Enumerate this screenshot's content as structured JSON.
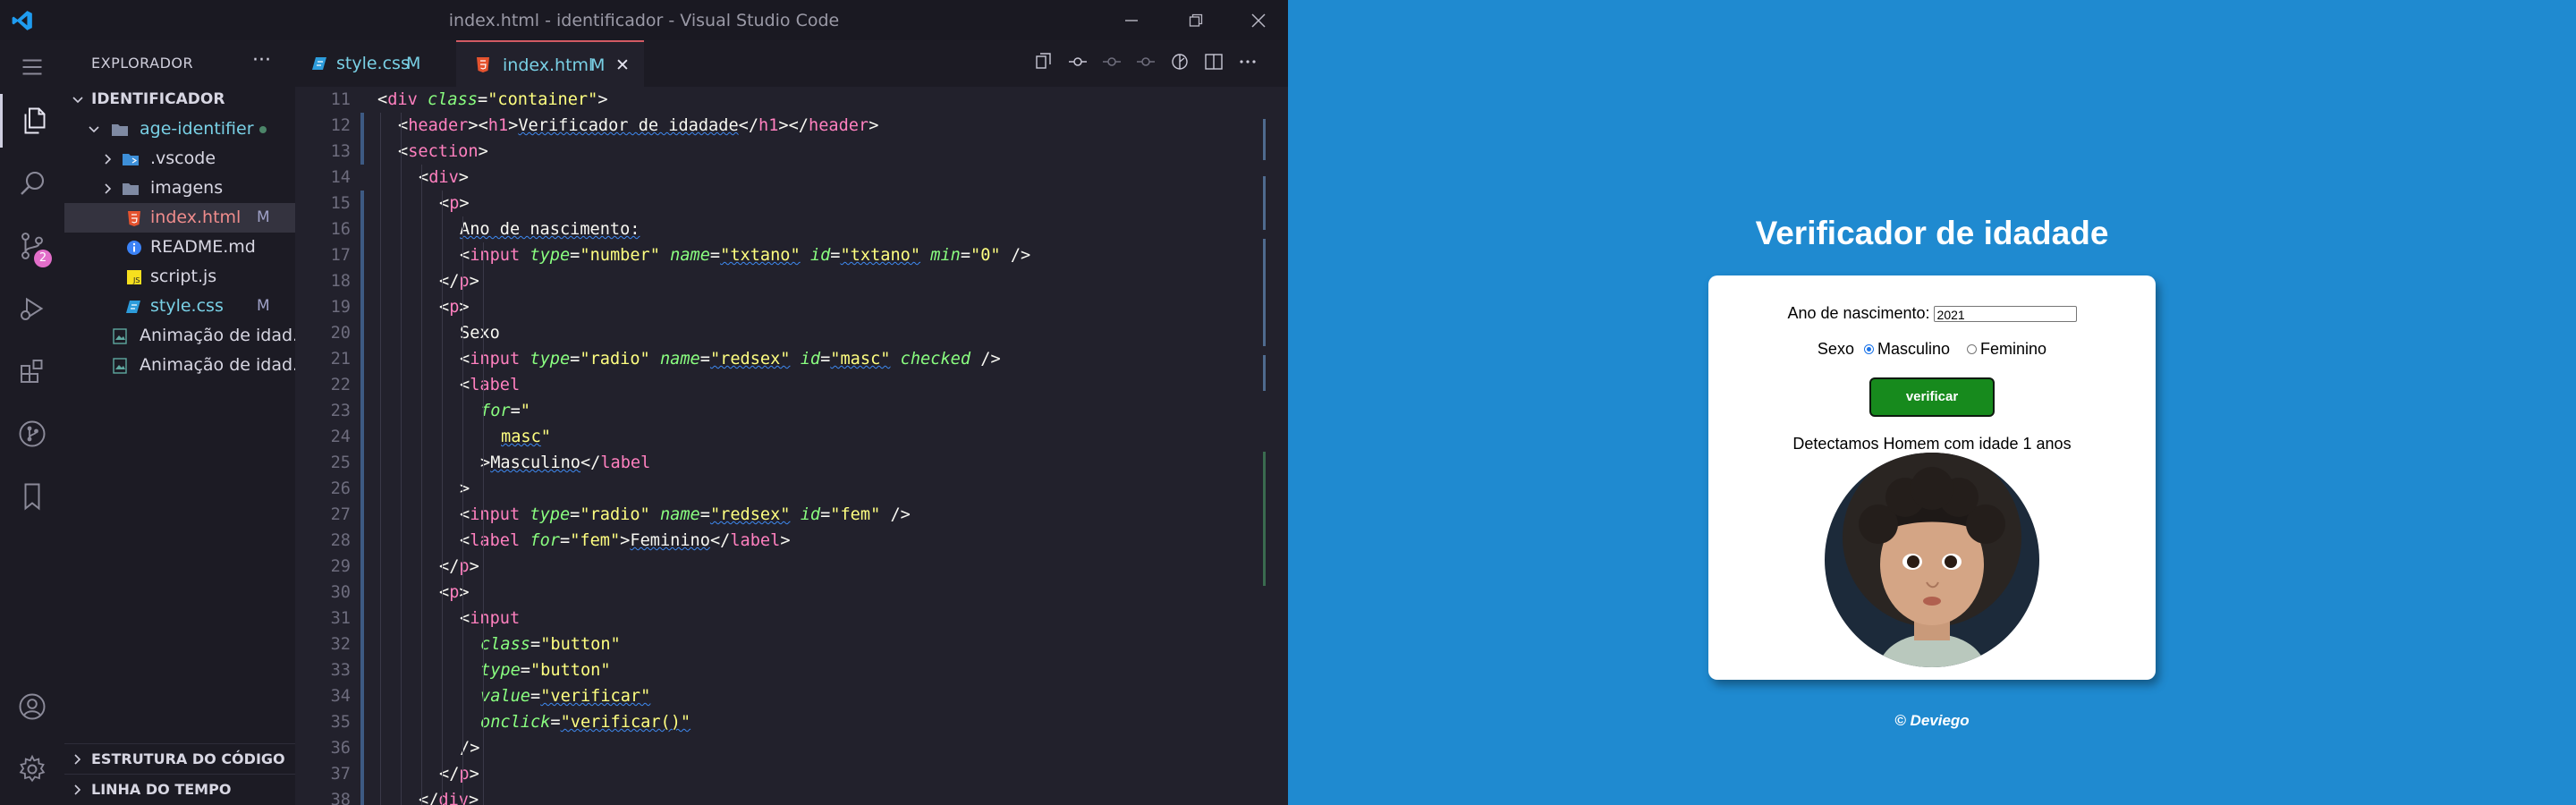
{
  "window": {
    "title": "index.html - identificador - Visual Studio Code"
  },
  "activity_bar": {
    "icons": [
      "explorer-icon",
      "search-icon",
      "source-control-icon",
      "run-debug-icon",
      "extensions-icon",
      "git-graph-icon",
      "bookmarks-icon",
      "account-icon",
      "settings-gear-icon"
    ],
    "source_control_badge": "2"
  },
  "sidebar": {
    "header": "EXPLORADOR",
    "more": "···",
    "root": "IDENTIFICADOR",
    "folder": "age-identifier",
    "items": [
      {
        "label": ".vscode",
        "kind": "folder",
        "flag": ""
      },
      {
        "label": "imagens",
        "kind": "folder",
        "flag": ""
      },
      {
        "label": "index.html",
        "kind": "html",
        "flag": "M"
      },
      {
        "label": "README.md",
        "kind": "info",
        "flag": ""
      },
      {
        "label": "script.js",
        "kind": "js",
        "flag": ""
      },
      {
        "label": "style.css",
        "kind": "css",
        "flag": "M"
      }
    ],
    "extra_items": [
      "Animação de idad...",
      "Animação de idad..."
    ],
    "sections": [
      "ESTRUTURA DO CÓDIGO",
      "LINHA DO TEMPO"
    ]
  },
  "tabs": [
    {
      "label": "style.css",
      "flag": "M",
      "active": false
    },
    {
      "label": "index.html",
      "flag": "M",
      "active": true
    }
  ],
  "close_glyph": "✕",
  "code_lines": [
    {
      "n": "11",
      "indent": 1,
      "tokens": [
        [
          "a",
          "<"
        ],
        [
          "t",
          "div"
        ],
        [
          "s",
          " "
        ],
        [
          "at",
          "class"
        ],
        [
          "a",
          "="
        ],
        [
          "st",
          "\"container\""
        ],
        [
          "a",
          ">"
        ]
      ]
    },
    {
      "n": "12",
      "indent": 2,
      "tokens": [
        [
          "a",
          "<"
        ],
        [
          "t",
          "header"
        ],
        [
          "a",
          "><"
        ],
        [
          "t",
          "h1"
        ],
        [
          "a",
          ">"
        ],
        [
          "x",
          "Verificador de idadade"
        ],
        [
          "a",
          "</"
        ],
        [
          "t",
          "h1"
        ],
        [
          "a",
          "></"
        ],
        [
          "t",
          "header"
        ],
        [
          "a",
          ">"
        ]
      ]
    },
    {
      "n": "13",
      "indent": 2,
      "tokens": [
        [
          "a",
          "<"
        ],
        [
          "t",
          "section"
        ],
        [
          "a",
          ">"
        ]
      ]
    },
    {
      "n": "14",
      "indent": 3,
      "tokens": [
        [
          "a",
          "<"
        ],
        [
          "t",
          "div"
        ],
        [
          "a",
          ">"
        ]
      ]
    },
    {
      "n": "15",
      "indent": 4,
      "tokens": [
        [
          "a",
          "<"
        ],
        [
          "t",
          "p"
        ],
        [
          "a",
          ">"
        ]
      ]
    },
    {
      "n": "16",
      "indent": 5,
      "tokens": [
        [
          "x",
          "Ano de nascimento:"
        ]
      ]
    },
    {
      "n": "17",
      "indent": 5,
      "tokens": [
        [
          "a",
          "<"
        ],
        [
          "t",
          "input"
        ],
        [
          "s",
          " "
        ],
        [
          "at",
          "type"
        ],
        [
          "a",
          "="
        ],
        [
          "st",
          "\"number\""
        ],
        [
          "s",
          " "
        ],
        [
          "at",
          "name"
        ],
        [
          "a",
          "="
        ],
        [
          "st",
          "\"txtano\""
        ],
        [
          "s",
          " "
        ],
        [
          "at",
          "id"
        ],
        [
          "a",
          "="
        ],
        [
          "st",
          "\"txtano\""
        ],
        [
          "s",
          " "
        ],
        [
          "at",
          "min"
        ],
        [
          "a",
          "="
        ],
        [
          "st",
          "\"0\""
        ],
        [
          "s",
          " "
        ],
        [
          "a",
          "/>"
        ]
      ]
    },
    {
      "n": "18",
      "indent": 4,
      "tokens": [
        [
          "a",
          "</"
        ],
        [
          "t",
          "p"
        ],
        [
          "a",
          ">"
        ]
      ]
    },
    {
      "n": "19",
      "indent": 4,
      "tokens": [
        [
          "a",
          "<"
        ],
        [
          "t",
          "p"
        ],
        [
          "a",
          ">"
        ]
      ]
    },
    {
      "n": "20",
      "indent": 5,
      "tokens": [
        [
          "x",
          "Sexo"
        ]
      ]
    },
    {
      "n": "21",
      "indent": 5,
      "tokens": [
        [
          "a",
          "<"
        ],
        [
          "t",
          "input"
        ],
        [
          "s",
          " "
        ],
        [
          "at",
          "type"
        ],
        [
          "a",
          "="
        ],
        [
          "st",
          "\"radio\""
        ],
        [
          "s",
          " "
        ],
        [
          "at",
          "name"
        ],
        [
          "a",
          "="
        ],
        [
          "st",
          "\"redsex\""
        ],
        [
          "s",
          " "
        ],
        [
          "at",
          "id"
        ],
        [
          "a",
          "="
        ],
        [
          "st",
          "\"masc\""
        ],
        [
          "s",
          " "
        ],
        [
          "at",
          "checked"
        ],
        [
          "s",
          " "
        ],
        [
          "a",
          "/>"
        ]
      ]
    },
    {
      "n": "22",
      "indent": 5,
      "tokens": [
        [
          "a",
          "<"
        ],
        [
          "t",
          "label"
        ]
      ]
    },
    {
      "n": "23",
      "indent": 6,
      "tokens": [
        [
          "at",
          "for"
        ],
        [
          "a",
          "="
        ],
        [
          "st",
          "\""
        ]
      ]
    },
    {
      "n": "24",
      "indent": 7,
      "tokens": [
        [
          "st",
          "masc"
        ],
        [
          "st",
          "\""
        ]
      ]
    },
    {
      "n": "25",
      "indent": 6,
      "tokens": [
        [
          "a",
          ">"
        ],
        [
          "x",
          "Masculino"
        ],
        [
          "a",
          "</"
        ],
        [
          "t",
          "label"
        ]
      ]
    },
    {
      "n": "26",
      "indent": 5,
      "tokens": [
        [
          "a",
          ">"
        ]
      ]
    },
    {
      "n": "27",
      "indent": 5,
      "tokens": [
        [
          "a",
          "<"
        ],
        [
          "t",
          "input"
        ],
        [
          "s",
          " "
        ],
        [
          "at",
          "type"
        ],
        [
          "a",
          "="
        ],
        [
          "st",
          "\"radio\""
        ],
        [
          "s",
          " "
        ],
        [
          "at",
          "name"
        ],
        [
          "a",
          "="
        ],
        [
          "st",
          "\"redsex\""
        ],
        [
          "s",
          " "
        ],
        [
          "at",
          "id"
        ],
        [
          "a",
          "="
        ],
        [
          "st",
          "\"fem\""
        ],
        [
          "s",
          " "
        ],
        [
          "a",
          "/>"
        ]
      ]
    },
    {
      "n": "28",
      "indent": 5,
      "tokens": [
        [
          "a",
          "<"
        ],
        [
          "t",
          "label"
        ],
        [
          "s",
          " "
        ],
        [
          "at",
          "for"
        ],
        [
          "a",
          "="
        ],
        [
          "st",
          "\"fem\""
        ],
        [
          "a",
          ">"
        ],
        [
          "x",
          "Feminino"
        ],
        [
          "a",
          "</"
        ],
        [
          "t",
          "label"
        ],
        [
          "a",
          ">"
        ]
      ]
    },
    {
      "n": "29",
      "indent": 4,
      "tokens": [
        [
          "a",
          "</"
        ],
        [
          "t",
          "p"
        ],
        [
          "a",
          ">"
        ]
      ]
    },
    {
      "n": "30",
      "indent": 4,
      "tokens": [
        [
          "a",
          "<"
        ],
        [
          "t",
          "p"
        ],
        [
          "a",
          ">"
        ]
      ]
    },
    {
      "n": "31",
      "indent": 5,
      "tokens": [
        [
          "a",
          "<"
        ],
        [
          "t",
          "input"
        ]
      ]
    },
    {
      "n": "32",
      "indent": 6,
      "tokens": [
        [
          "at",
          "class"
        ],
        [
          "a",
          "="
        ],
        [
          "st",
          "\"button\""
        ]
      ]
    },
    {
      "n": "33",
      "indent": 6,
      "tokens": [
        [
          "at",
          "type"
        ],
        [
          "a",
          "="
        ],
        [
          "st",
          "\"button\""
        ]
      ]
    },
    {
      "n": "34",
      "indent": 6,
      "tokens": [
        [
          "at",
          "value"
        ],
        [
          "a",
          "="
        ],
        [
          "st",
          "\"verificar\""
        ]
      ]
    },
    {
      "n": "35",
      "indent": 6,
      "tokens": [
        [
          "at",
          "onclick"
        ],
        [
          "a",
          "="
        ],
        [
          "st",
          "\"verificar()\""
        ]
      ]
    },
    {
      "n": "36",
      "indent": 5,
      "tokens": [
        [
          "a",
          "/>"
        ]
      ]
    },
    {
      "n": "37",
      "indent": 4,
      "tokens": [
        [
          "a",
          "</"
        ],
        [
          "t",
          "p"
        ],
        [
          "a",
          ">"
        ]
      ]
    },
    {
      "n": "38",
      "indent": 3,
      "tokens": [
        [
          "a",
          "</"
        ],
        [
          "t",
          "div"
        ],
        [
          "a",
          ">"
        ]
      ]
    }
  ],
  "colors": {
    "tag": "#ff80bf",
    "attribute": "#8aff80",
    "string": "#ffff80",
    "text": "#f8f8f2",
    "page_background": "#1f8ad0",
    "button": "#178a1d"
  },
  "site": {
    "heading": "Verificador de idadade",
    "year_label": "Ano de nascimento:",
    "year_value": "2021",
    "sex_label": "Sexo",
    "option_male": "Masculino",
    "option_female": "Feminino",
    "selected_option": "Masculino",
    "button_label": "verificar",
    "result": "Detectamos Homem com idade 1 anos",
    "footer": "© Deviego"
  }
}
